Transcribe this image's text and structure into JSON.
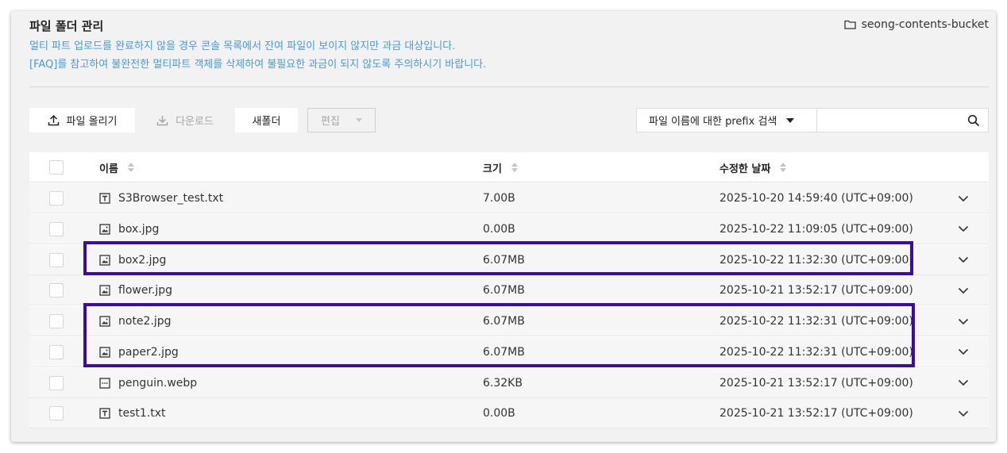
{
  "header": {
    "title": "파일 폴더 관리",
    "bucket": "seong-contents-bucket",
    "notice_line1": "멀티 파트 업로드를 완료하지 않을 경우 콘솔 목록에서 잔여 파일이 보이지 않지만 과금 대상입니다.",
    "notice_line2": "[FAQ]를 참고하여 불완전한 멀티파트 객체를 삭제하여 불필요한 과금이 되지 않도록 주의하시기 바랍니다."
  },
  "toolbar": {
    "upload_label": "파일 올리기",
    "download_label": "다운로드",
    "newfolder_label": "새폴더",
    "edit_label": "편집",
    "search_mode": "파일 이름에 대한 prefix 검색",
    "search_value": ""
  },
  "table": {
    "columns": [
      "이름",
      "크기",
      "수정한 날짜"
    ],
    "rows": [
      {
        "name": "S3Browser_test.txt",
        "size": "7.00B",
        "date": "2025-10-20 14:59:40 (UTC+09:00)",
        "icon": "text-file-icon"
      },
      {
        "name": "box.jpg",
        "size": "0.00B",
        "date": "2025-10-22 11:09:05 (UTC+09:00)",
        "icon": "image-file-icon"
      },
      {
        "name": "box2.jpg",
        "size": "6.07MB",
        "date": "2025-10-22 11:32:30 (UTC+09:00)",
        "icon": "image-file-icon"
      },
      {
        "name": "flower.jpg",
        "size": "6.07MB",
        "date": "2025-10-21 13:52:17 (UTC+09:00)",
        "icon": "image-file-icon"
      },
      {
        "name": "note2.jpg",
        "size": "6.07MB",
        "date": "2025-10-22 11:32:31 (UTC+09:00)",
        "icon": "image-file-icon"
      },
      {
        "name": "paper2.jpg",
        "size": "6.07MB",
        "date": "2025-10-22 11:32:31 (UTC+09:00)",
        "icon": "image-file-icon"
      },
      {
        "name": "penguin.webp",
        "size": "6.32KB",
        "date": "2025-10-21 13:52:17 (UTC+09:00)",
        "icon": "generic-file-icon"
      },
      {
        "name": "test1.txt",
        "size": "0.00B",
        "date": "2025-10-21 13:52:17 (UTC+09:00)",
        "icon": "text-file-icon"
      }
    ]
  },
  "colors": {
    "notice": "#4a9ad8",
    "highlight": "#3a0ca3",
    "panel": "#f2f2f2"
  }
}
